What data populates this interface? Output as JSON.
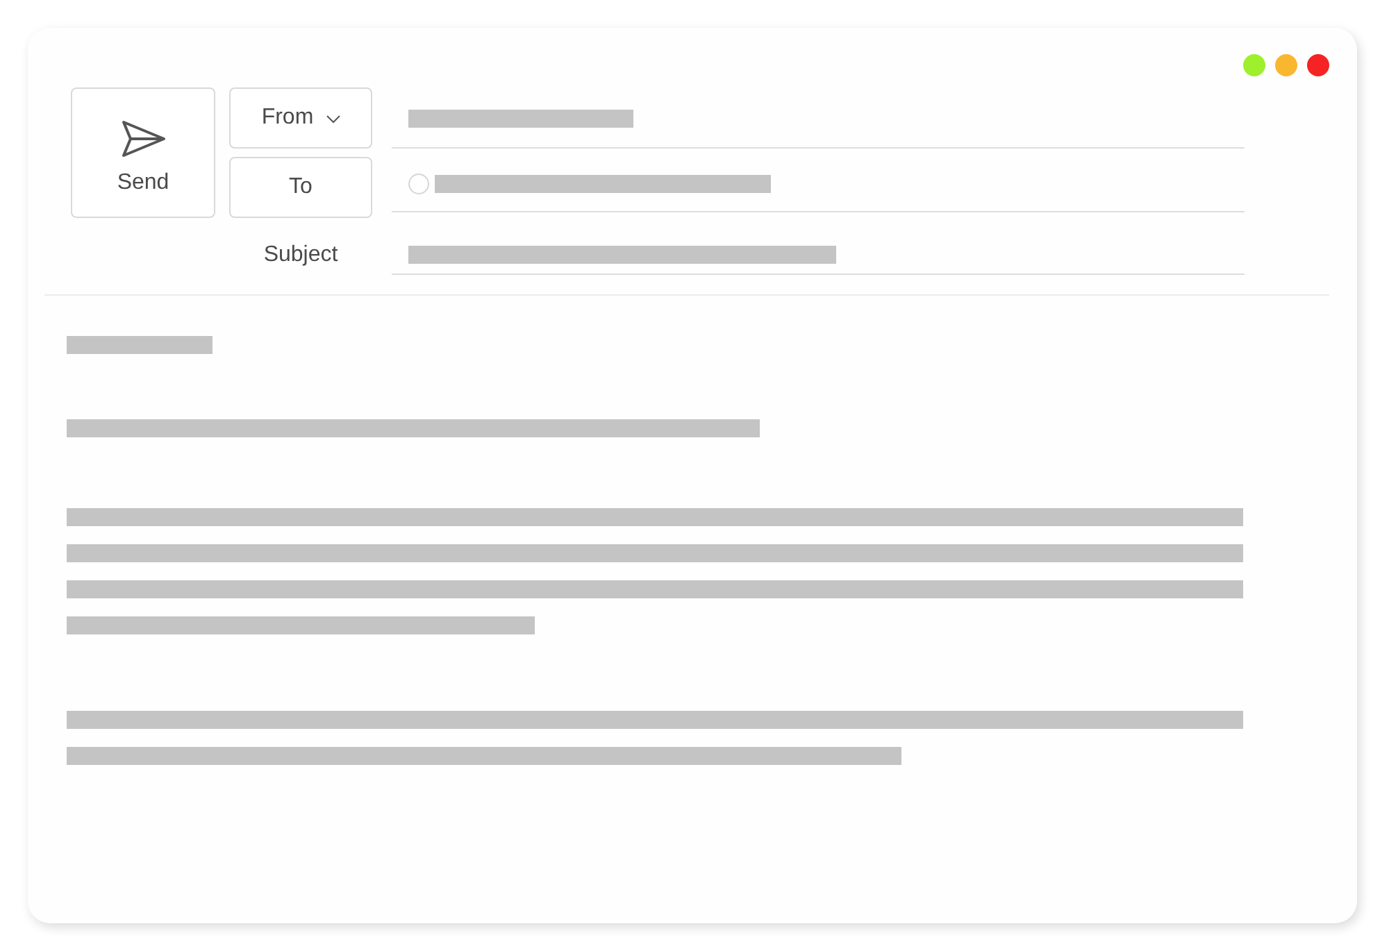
{
  "window_controls": [
    {
      "color": "#9ef02c"
    },
    {
      "color": "#f9b730"
    },
    {
      "color": "#f52323"
    }
  ],
  "send_button": {
    "label": "Send"
  },
  "header_fields": [
    {
      "kind": "dropdown",
      "label": "From",
      "contact_icon": false
    },
    {
      "kind": "button",
      "label": "To",
      "contact_icon": true
    },
    {
      "kind": "label",
      "label": "Subject",
      "contact_icon": false
    }
  ]
}
